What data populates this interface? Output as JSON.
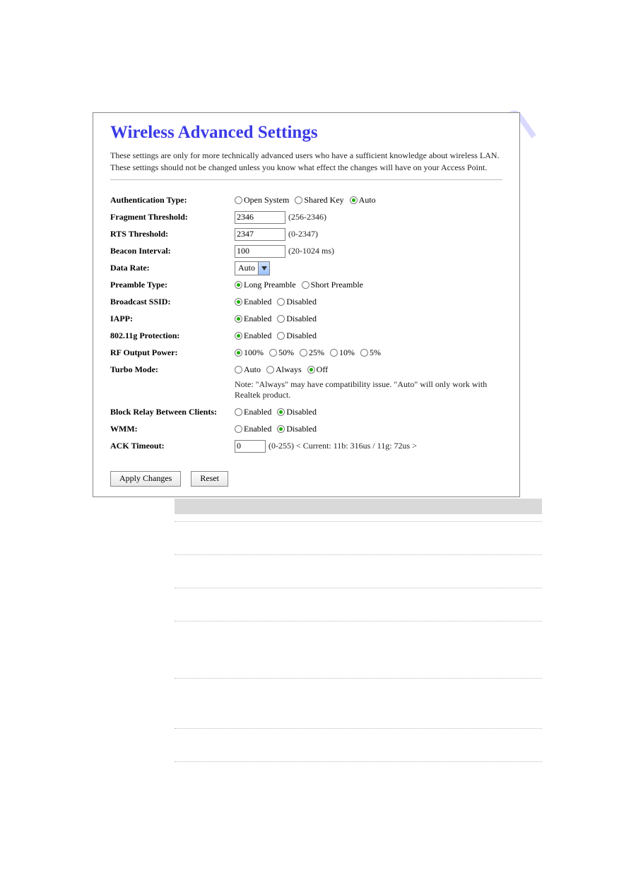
{
  "watermark": "manualshive.com",
  "title": "Wireless Advanced Settings",
  "description": "These settings are only for more technically advanced users who have a sufficient knowledge about wireless LAN. These settings should not be changed unless you know what effect the changes will have on your Access Point.",
  "rows": {
    "auth_type": {
      "label": "Authentication Type:",
      "options": [
        "Open System",
        "Shared Key",
        "Auto"
      ],
      "selected": "Auto"
    },
    "fragment_threshold": {
      "label": "Fragment Threshold:",
      "value": "2346",
      "hint": "(256-2346)"
    },
    "rts_threshold": {
      "label": "RTS Threshold:",
      "value": "2347",
      "hint": "(0-2347)"
    },
    "beacon_interval": {
      "label": "Beacon Interval:",
      "value": "100",
      "hint": "(20-1024 ms)"
    },
    "data_rate": {
      "label": "Data Rate:",
      "selected": "Auto"
    },
    "preamble_type": {
      "label": "Preamble Type:",
      "options": [
        "Long Preamble",
        "Short Preamble"
      ],
      "selected": "Long Preamble"
    },
    "broadcast_ssid": {
      "label": "Broadcast SSID:",
      "options": [
        "Enabled",
        "Disabled"
      ],
      "selected": "Enabled"
    },
    "iapp": {
      "label": "IAPP:",
      "options": [
        "Enabled",
        "Disabled"
      ],
      "selected": "Enabled"
    },
    "protection": {
      "label": "802.11g Protection:",
      "options": [
        "Enabled",
        "Disabled"
      ],
      "selected": "Enabled"
    },
    "rf_output_power": {
      "label": "RF Output Power:",
      "options": [
        "100%",
        "50%",
        "25%",
        "10%",
        "5%"
      ],
      "selected": "100%"
    },
    "turbo_mode": {
      "label": "Turbo Mode:",
      "options": [
        "Auto",
        "Always",
        "Off"
      ],
      "selected": "Off",
      "note": "Note: \"Always\" may have compatibility issue. \"Auto\" will only work with Realtek product."
    },
    "block_relay": {
      "label": "Block Relay Between Clients:",
      "options": [
        "Enabled",
        "Disabled"
      ],
      "selected": "Disabled"
    },
    "wmm": {
      "label": "WMM:",
      "options": [
        "Enabled",
        "Disabled"
      ],
      "selected": "Disabled"
    },
    "ack_timeout": {
      "label": "ACK Timeout:",
      "value": "0",
      "hint": "(0-255)  < Current: 11b: 316us / 11g: 72us >"
    }
  },
  "buttons": {
    "apply": "Apply Changes",
    "reset": "Reset"
  }
}
